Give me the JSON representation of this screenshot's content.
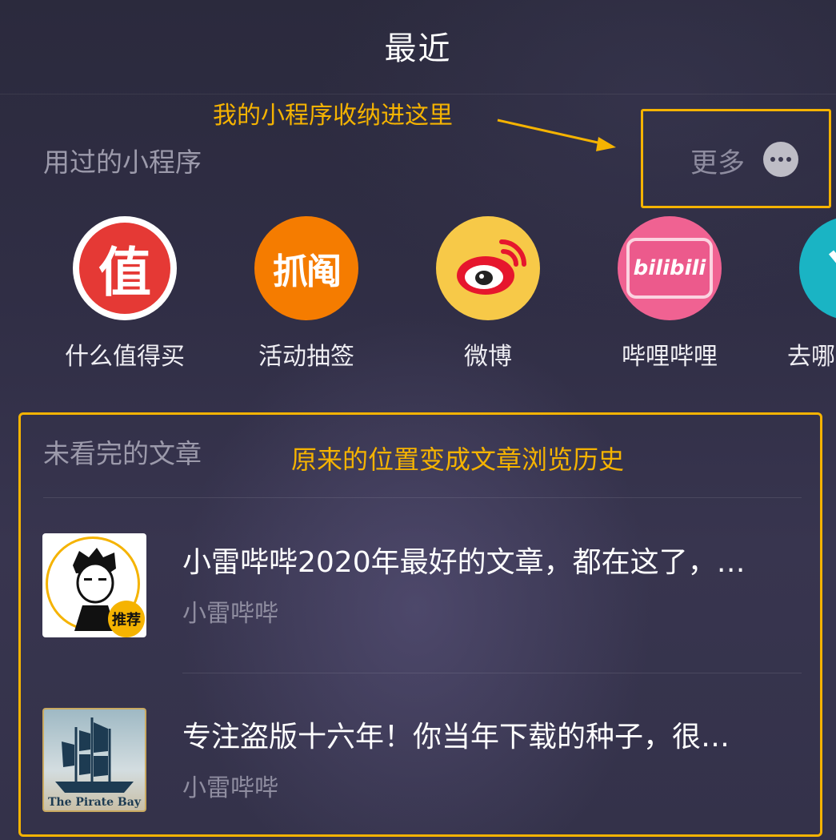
{
  "header": {
    "title": "最近"
  },
  "annotations": {
    "mini_programs_note": "我的小程序收纳进这里",
    "articles_note": "原来的位置变成文章浏览历史"
  },
  "mini_programs": {
    "section_label": "用过的小程序",
    "more_label": "更多",
    "items": [
      {
        "label": "什么值得买",
        "icon": "zhi-icon",
        "icon_text": "值",
        "color": "#e53935"
      },
      {
        "label": "活动抽签",
        "icon": "zhuawa-icon",
        "icon_text": "抓阄",
        "color": "#f57c00"
      },
      {
        "label": "微博",
        "icon": "weibo-icon",
        "color": "#f7c948"
      },
      {
        "label": "哔哩哔哩",
        "icon": "bilibili-icon",
        "icon_text": "bilibili",
        "color": "#f06292"
      },
      {
        "label": "去哪",
        "icon": "qunar-icon",
        "color": "#1ab4c4"
      }
    ]
  },
  "articles": {
    "section_label": "未看完的文章",
    "items": [
      {
        "title": "小雷哔哔2020年最好的文章，都在这了，…",
        "source": "小雷哔哔",
        "thumb": "avatar-recommend-thumbnail",
        "badge": "推荐"
      },
      {
        "title": "专注盗版十六年！你当年下载的种子，很…",
        "source": "小雷哔哔",
        "thumb": "pirate-bay-thumbnail",
        "thumb_caption": "The Pirate Bay"
      }
    ]
  }
}
